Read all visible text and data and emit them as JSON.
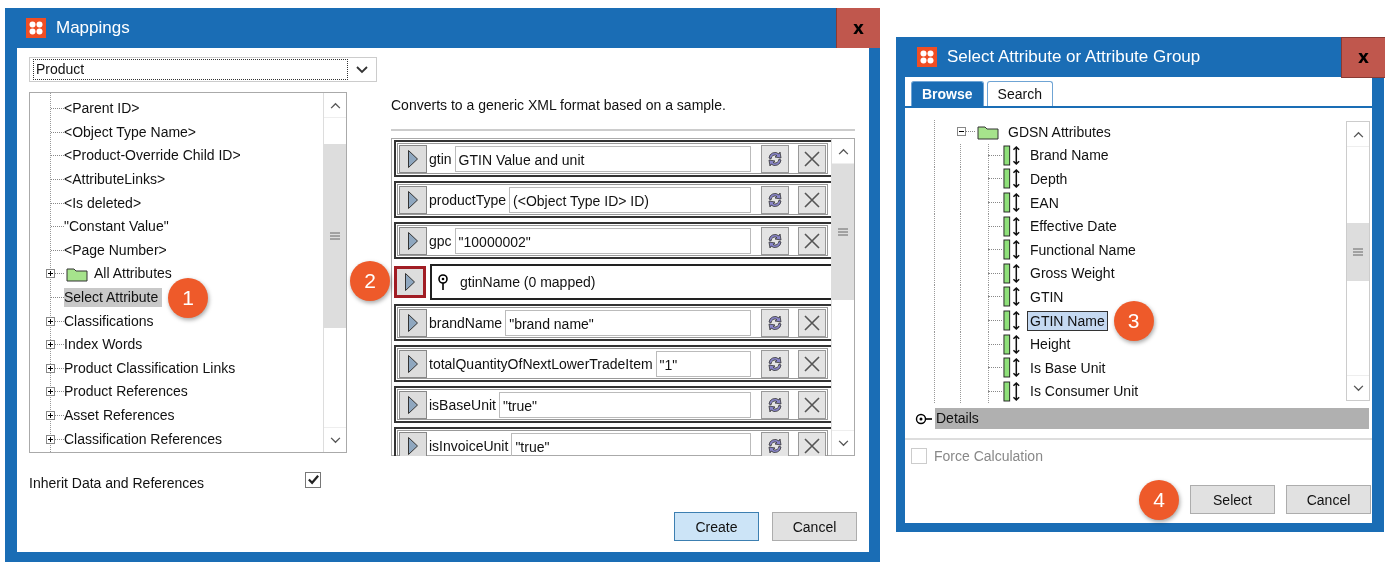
{
  "mappings_window": {
    "title": "Mappings",
    "close": "x",
    "type_select": {
      "value": "Product"
    },
    "tree": [
      {
        "label": "<Parent ID>",
        "kind": "leaf",
        "selected": false
      },
      {
        "label": "<Object Type Name>",
        "kind": "leaf",
        "selected": false
      },
      {
        "label": "<Product-Override Child ID>",
        "kind": "leaf",
        "selected": false
      },
      {
        "label": "<AttributeLinks>",
        "kind": "leaf",
        "selected": false
      },
      {
        "label": "<Is deleted>",
        "kind": "leaf",
        "selected": false
      },
      {
        "label": "\"Constant Value\"",
        "kind": "leaf",
        "selected": false
      },
      {
        "label": "<Page Number>",
        "kind": "leaf",
        "selected": false
      },
      {
        "label": "All Attributes",
        "kind": "folder",
        "expanded": false,
        "selected": false
      },
      {
        "label": "Select Attribute",
        "kind": "leaf",
        "selected": true,
        "callout": "1"
      },
      {
        "label": "Classifications",
        "kind": "group",
        "expanded": false,
        "selected": false
      },
      {
        "label": "Index Words",
        "kind": "group",
        "expanded": false,
        "selected": false
      },
      {
        "label": "Product Classification Links",
        "kind": "group",
        "expanded": false,
        "selected": false
      },
      {
        "label": "Product References",
        "kind": "group",
        "expanded": false,
        "selected": false
      },
      {
        "label": "Asset References",
        "kind": "group",
        "expanded": false,
        "selected": false
      },
      {
        "label": "Classification References",
        "kind": "group",
        "expanded": false,
        "selected": false
      }
    ],
    "inherit": {
      "label": "Inherit Data and References",
      "checked": true
    },
    "description": "Converts to a generic XML format based on a sample.",
    "mapping_rows": [
      {
        "kind": "field",
        "name": "gtin",
        "value": "GTIN Value and unit",
        "highlighted": false
      },
      {
        "kind": "field",
        "name": "productType",
        "value": "(<Object Type ID> ID)",
        "highlighted": false
      },
      {
        "kind": "field",
        "name": "gpc",
        "value": "\"10000002\"",
        "highlighted": false
      },
      {
        "kind": "group",
        "name": "gtinName (0 mapped)",
        "highlighted": true,
        "callout": "2"
      },
      {
        "kind": "field",
        "name": "brandName",
        "value": "\"brand name\"",
        "highlighted": false
      },
      {
        "kind": "field",
        "name": "totalQuantityOfNextLowerTradeItem",
        "value": "\"1\"",
        "highlighted": false
      },
      {
        "kind": "field",
        "name": "isBaseUnit",
        "value": "\"true\"",
        "highlighted": false
      },
      {
        "kind": "field",
        "name": "isInvoiceUnit",
        "value": "\"true\"",
        "highlighted": false
      }
    ],
    "buttons": [
      {
        "label": "Create",
        "default": true
      },
      {
        "label": "Cancel",
        "default": false
      }
    ]
  },
  "select_window": {
    "title": "Select Attribute or Attribute Group",
    "close": "x",
    "tabs": [
      {
        "label": "Browse",
        "selected": true
      },
      {
        "label": "Search",
        "selected": false
      }
    ],
    "tree": {
      "label": "GDSN Attributes",
      "expanded": true,
      "children": [
        {
          "label": "Brand Name",
          "selected": false
        },
        {
          "label": "Depth",
          "selected": false
        },
        {
          "label": "EAN",
          "selected": false
        },
        {
          "label": "Effective Date",
          "selected": false
        },
        {
          "label": "Functional Name",
          "selected": false
        },
        {
          "label": "Gross Weight",
          "selected": false
        },
        {
          "label": "GTIN",
          "selected": false
        },
        {
          "label": "GTIN Name",
          "selected": true,
          "callout": "3"
        },
        {
          "label": "Height",
          "selected": false
        },
        {
          "label": "Is Base Unit",
          "selected": false
        },
        {
          "label": "Is Consumer Unit",
          "selected": false
        }
      ]
    },
    "details": {
      "label": "Details"
    },
    "force_calculation": {
      "label": "Force Calculation",
      "checked": false,
      "disabled": true
    },
    "footer_callout": "4",
    "buttons": [
      {
        "label": "Select",
        "default": false
      },
      {
        "label": "Cancel",
        "default": false
      }
    ]
  }
}
